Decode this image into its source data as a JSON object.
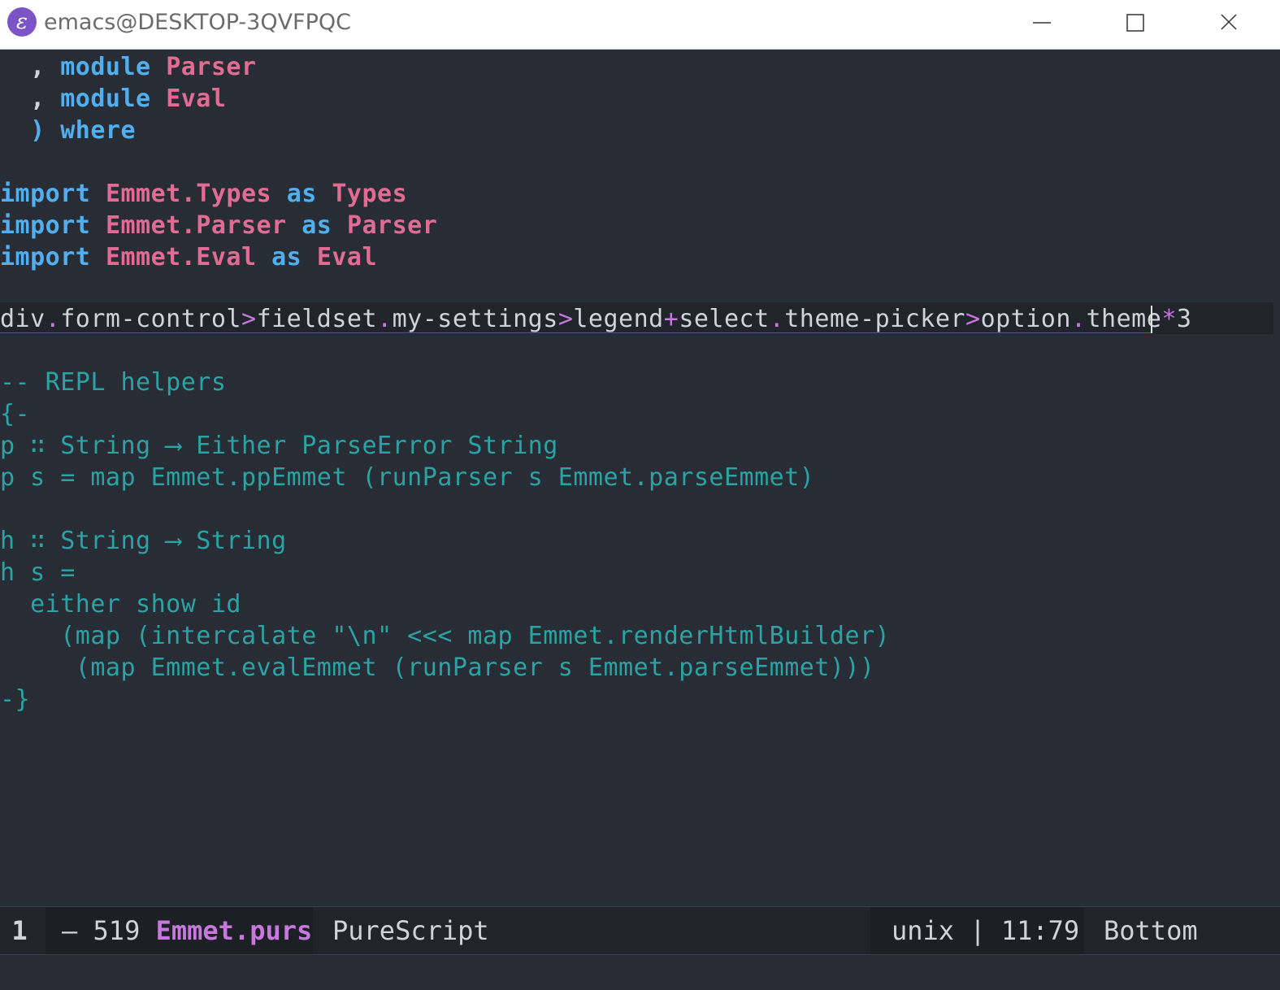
{
  "window": {
    "title": "emacs@DESKTOP-3QVFPQC",
    "app_icon": "emacs-icon",
    "controls": [
      "minimize-icon",
      "maximize-icon",
      "close-icon"
    ]
  },
  "editor": {
    "lines": {
      "l1": {
        "a": "  , ",
        "b": "module",
        "c": " ",
        "d": "Parser"
      },
      "l2": {
        "a": "  , ",
        "b": "module",
        "c": " ",
        "d": "Eval"
      },
      "l3": {
        "a": "  ) ",
        "b": "where"
      },
      "l5": {
        "a": "import",
        "b": " ",
        "c": "Emmet.Types",
        "d": " ",
        "e": "as",
        "f": " ",
        "g": "Types"
      },
      "l6": {
        "a": "import",
        "b": " ",
        "c": "Emmet.Parser",
        "d": " ",
        "e": "as",
        "f": " ",
        "g": "Parser"
      },
      "l7": {
        "a": "import",
        "b": " ",
        "c": "Emmet.Eval",
        "d": " ",
        "e": "as",
        "f": " ",
        "g": "Eval"
      },
      "l9": {
        "a": "div",
        "b": ".",
        "c": "form-control",
        "d": ">",
        "e": "fieldset",
        "f": ".",
        "g": "my-settings",
        "h": ">",
        "i": "legend",
        "j": "+",
        "k": "select",
        "l": ".",
        "m": "theme-picker",
        "n": ">",
        "o": "option",
        "p": ".",
        "q": "theme",
        "r": "*",
        "s": "3"
      },
      "l11": "-- REPL helpers",
      "l12": "{-",
      "l13": "p ∷ String ⟶ Either ParseError String",
      "l14": "p s = map Emmet.ppEmmet (runParser s Emmet.parseEmmet)",
      "l16": "h ∷ String ⟶ String",
      "l17": "h s =",
      "l18": "  either show id",
      "l19": "    (map (intercalate \"\\n\" <<< map Emmet.renderHtmlBuilder)",
      "l20": "     (map Emmet.evalEmmet (runParser s Emmet.parseEmmet)))",
      "l21": "-}"
    }
  },
  "modeline": {
    "window_number": "1",
    "state": "– 519 ",
    "buffer_name": "Emmet.purs",
    "major_mode": "PureScript",
    "encoding": "unix | 11:79",
    "position": "Bottom"
  },
  "colors": {
    "background": "#282c34",
    "keyword": "#51afef",
    "type": "#e06c94",
    "comment": "#2ba2a4",
    "operator": "#c678dd"
  }
}
